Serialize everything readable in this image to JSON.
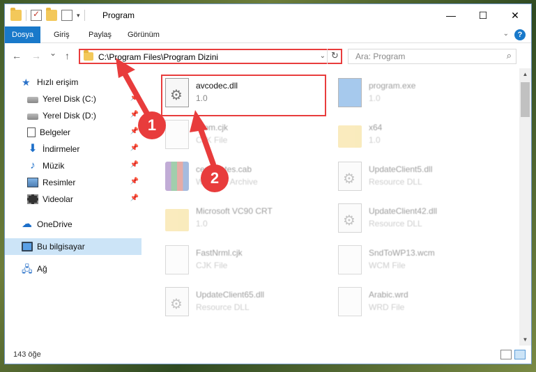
{
  "window": {
    "title": "Program",
    "controls": [
      "—",
      "☐",
      "✕"
    ]
  },
  "ribbon": {
    "tabs": [
      "Dosya",
      "Giriş",
      "Paylaş",
      "Görünüm"
    ],
    "help": "?"
  },
  "nav": {
    "back": "←",
    "forward": "→",
    "recent": "⌄",
    "up": "↑",
    "address": "C:\\Program Files\\Program Dizini",
    "address_dropdown": "⌄",
    "refresh": "↻",
    "search_placeholder": "Ara: Program",
    "search_icon": "⌕"
  },
  "sidebar": {
    "items": [
      {
        "label": "Hızlı erişim",
        "icon": "star-icon"
      },
      {
        "label": "Yerel Disk (C:)",
        "icon": "drive-icon"
      },
      {
        "label": "Yerel Disk (D:)",
        "icon": "drive-icon"
      },
      {
        "label": "Belgeler",
        "icon": "document-icon"
      },
      {
        "label": "İndirmeler",
        "icon": "download-icon"
      },
      {
        "label": "Müzik",
        "icon": "music-icon"
      },
      {
        "label": "Resimler",
        "icon": "pictures-icon"
      },
      {
        "label": "Videolar",
        "icon": "videos-icon"
      },
      {
        "label": "OneDrive",
        "icon": "cloud-icon"
      },
      {
        "label": "Bu bilgisayar",
        "icon": "computer-icon"
      },
      {
        "label": "Ağ",
        "icon": "network-icon"
      }
    ],
    "pin_glyph": "📌"
  },
  "files": {
    "left": [
      {
        "name": "avcodec.dll",
        "meta": "1.0",
        "icon": "dll-icon"
      },
      {
        "name": "Atom.cjk",
        "meta": "CJK File",
        "icon": "document-icon"
      },
      {
        "name": "certificates.cab",
        "meta": "WinRAR Archive",
        "icon": "archive-icon"
      },
      {
        "name": "Microsoft VC90 CRT",
        "meta": "1.0",
        "icon": "folder-icon"
      },
      {
        "name": "FastNrml.cjk",
        "meta": "CJK File",
        "icon": "document-icon"
      },
      {
        "name": "UpdateClient65.dll",
        "meta": "Resource DLL",
        "icon": "dll-icon"
      }
    ],
    "right": [
      {
        "name": "program.exe",
        "meta": "1.0",
        "icon": "exe-icon"
      },
      {
        "name": "x64",
        "meta": "1.0",
        "icon": "folder-icon"
      },
      {
        "name": "UpdateClient5.dll",
        "meta": "Resource DLL",
        "icon": "dll-icon"
      },
      {
        "name": "UpdateClient42.dll",
        "meta": "Resource DLL",
        "icon": "dll-icon"
      },
      {
        "name": "SndToWP13.wcm",
        "meta": "WCM File",
        "icon": "document-icon"
      },
      {
        "name": "Arabic.wrd",
        "meta": "WRD File",
        "icon": "document-icon"
      }
    ]
  },
  "status": {
    "count": "143 öğe"
  },
  "callouts": [
    "1",
    "2"
  ],
  "colors": {
    "accent": "#1979ca",
    "highlight": "#e83c3c",
    "selected": "#cce4f7"
  }
}
